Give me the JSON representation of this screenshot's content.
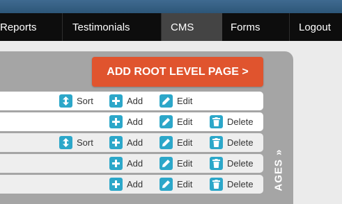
{
  "nav": {
    "items": [
      {
        "label": "Reports",
        "active": false
      },
      {
        "label": "Testimonials",
        "active": false
      },
      {
        "label": "CMS",
        "active": true
      },
      {
        "label": "Forms",
        "active": false
      },
      {
        "label": "Logout",
        "active": false
      }
    ]
  },
  "add_root_button": "ADD ROOT LEVEL PAGE >",
  "side_tab": "AGES »",
  "rows": [
    {
      "sort": "Sort",
      "add": "Add",
      "edit": "Edit"
    },
    {
      "add": "Add",
      "edit": "Edit",
      "delete": "Delete"
    },
    {
      "sort": "Sort",
      "add": "Add",
      "edit": "Edit",
      "delete": "Delete"
    },
    {
      "add": "Add",
      "edit": "Edit",
      "delete": "Delete"
    },
    {
      "add": "Add",
      "edit": "Edit",
      "delete": "Delete"
    }
  ],
  "colors": {
    "topbar": "#35608a",
    "nav_bg": "#0d0d0d",
    "nav_active": "#444444",
    "primary_button": "#e0542e",
    "icon_accent": "#2ca7c9",
    "panel": "#a5a5a5"
  }
}
